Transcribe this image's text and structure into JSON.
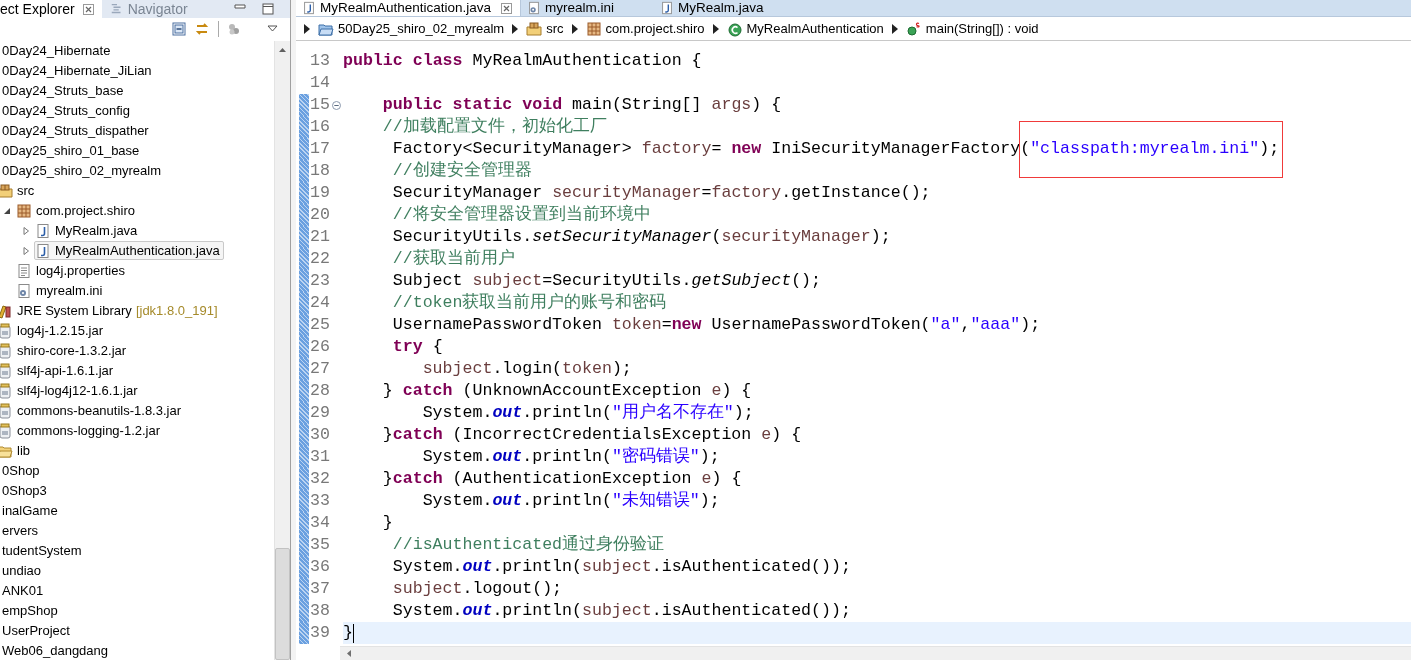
{
  "sidebar": {
    "tabs": [
      {
        "label": "ect Explorer",
        "selected": true
      },
      {
        "label": "Navigator",
        "kind": "navigator",
        "selected": false
      }
    ],
    "tree": [
      {
        "label": "0Day24_Hibernate",
        "selected": false
      },
      {
        "label": "0Day24_Hibernate_JiLian",
        "selected": false
      },
      {
        "label": "0Day24_Struts_base",
        "selected": false
      },
      {
        "label": "0Day24_Struts_config",
        "selected": false
      },
      {
        "label": "0Day24_Struts_dispather",
        "selected": false
      },
      {
        "label": "0Day25_shiro_01_base",
        "selected": false
      },
      {
        "label": "0Day25_shiro_02_myrealm",
        "selected": false,
        "children": [
          {
            "label": "src",
            "kind": "source-folder",
            "selected": false,
            "children": [
              {
                "label": "com.project.shiro",
                "kind": "package",
                "expanded": true,
                "selected": false,
                "children": [
                  {
                    "label": "MyRealm.java",
                    "kind": "java",
                    "expanded": false,
                    "selected": false
                  },
                  {
                    "label": "MyRealmAuthentication.java",
                    "kind": "java",
                    "expanded": false,
                    "selected": true
                  }
                ]
              },
              {
                "label": "log4j.properties",
                "kind": "properties",
                "selected": false
              },
              {
                "label": "myrealm.ini",
                "kind": "ini",
                "selected": false
              }
            ]
          },
          {
            "label": "JRE System Library",
            "decoration": "[jdk1.8.0_191]",
            "kind": "library",
            "selected": false
          },
          {
            "label": "log4j-1.2.15.jar",
            "kind": "jar",
            "selected": false
          },
          {
            "label": "shiro-core-1.3.2.jar",
            "kind": "jar",
            "selected": false
          },
          {
            "label": "slf4j-api-1.6.1.jar",
            "kind": "jar",
            "selected": false
          },
          {
            "label": "slf4j-log4j12-1.6.1.jar",
            "kind": "jar",
            "selected": false
          },
          {
            "label": "commons-beanutils-1.8.3.jar",
            "kind": "jar",
            "selected": false
          },
          {
            "label": "commons-logging-1.2.jar",
            "kind": "jar",
            "selected": false
          },
          {
            "label": "lib",
            "kind": "folder",
            "selected": false
          }
        ]
      },
      {
        "label": "0Shop",
        "selected": false
      },
      {
        "label": "0Shop3",
        "selected": false
      },
      {
        "label": "inalGame",
        "selected": false
      },
      {
        "label": "ervers",
        "selected": false
      },
      {
        "label": "tudentSystem",
        "selected": false
      },
      {
        "label": "undiao",
        "selected": false
      },
      {
        "label": "ANK01",
        "selected": false
      },
      {
        "label": "empShop",
        "selected": false
      },
      {
        "label": "UserProject",
        "selected": false
      },
      {
        "label": "Web06_dangdang",
        "selected": false
      }
    ]
  },
  "editor": {
    "tabs": [
      {
        "label": "MyRealmAuthentication.java",
        "kind": "java",
        "selected": true
      },
      {
        "label": "myrealm.ini",
        "kind": "ini",
        "selected": false
      },
      {
        "label": "MyRealm.java",
        "kind": "java",
        "selected": false
      }
    ],
    "breadcrumb": [
      {
        "label": "50Day25_shiro_02_myrealm",
        "kind": "project"
      },
      {
        "label": "src",
        "kind": "source-folder"
      },
      {
        "label": "com.project.shiro",
        "kind": "package"
      },
      {
        "label": "MyRealmAuthentication",
        "kind": "class"
      },
      {
        "label": "main(String[]) : void",
        "kind": "method"
      }
    ],
    "lines": [
      {
        "number": "13",
        "changed": false,
        "current": false,
        "tokens": [
          {
            "text": "public ",
            "kind": "keyword"
          },
          {
            "text": "class ",
            "kind": "keyword"
          },
          {
            "text": "MyRealmAuthentication {",
            "kind": "plain"
          }
        ]
      },
      {
        "number": "14",
        "changed": false,
        "current": false
      },
      {
        "number": "15",
        "changed": true,
        "current": false,
        "folded": false,
        "tokens": [
          {
            "text": "    public ",
            "kind": "keyword"
          },
          {
            "text": "static ",
            "kind": "keyword"
          },
          {
            "text": "void",
            "kind": "keyword"
          },
          {
            "text": " main(String[] ",
            "kind": "plain"
          },
          {
            "text": "args",
            "kind": "variable"
          },
          {
            "text": ") {",
            "kind": "plain"
          }
        ]
      },
      {
        "number": "16",
        "changed": true,
        "current": false,
        "tokens": [
          {
            "text": "    //加载配置文件，初始化工厂",
            "kind": "comment"
          }
        ]
      },
      {
        "number": "17",
        "changed": true,
        "current": false,
        "tokens": [
          {
            "text": "     Factory<SecurityManager> ",
            "kind": "plain"
          },
          {
            "text": "factory",
            "kind": "variable"
          },
          {
            "text": "= ",
            "kind": "plain"
          },
          {
            "text": "new",
            "kind": "keyword"
          },
          {
            "text": " IniSecurityManagerFactory",
            "kind": "plain"
          },
          {
            "text": "(",
            "kind": "plain",
            "boxed": true
          },
          {
            "text": "\"classpath:myrealm.ini\"",
            "kind": "string",
            "boxed": true
          },
          {
            "text": ");",
            "kind": "plain",
            "boxed": true
          }
        ]
      },
      {
        "number": "18",
        "changed": true,
        "current": false,
        "tokens": [
          {
            "text": "     //创建安全管理器",
            "kind": "comment"
          }
        ]
      },
      {
        "number": "19",
        "changed": true,
        "current": false,
        "tokens": [
          {
            "text": "     SecurityManager ",
            "kind": "plain"
          },
          {
            "text": "securityManager",
            "kind": "variable"
          },
          {
            "text": "=",
            "kind": "plain"
          },
          {
            "text": "factory",
            "kind": "variable"
          },
          {
            "text": ".getInstance();",
            "kind": "plain"
          }
        ]
      },
      {
        "number": "20",
        "changed": true,
        "current": false,
        "tokens": [
          {
            "text": "     //将安全管理器设置到当前环境中",
            "kind": "comment"
          }
        ]
      },
      {
        "number": "21",
        "changed": true,
        "current": false,
        "tokens": [
          {
            "text": "     SecurityUtils.",
            "kind": "plain"
          },
          {
            "text": "setSecurityManager",
            "kind": "static"
          },
          {
            "text": "(",
            "kind": "plain"
          },
          {
            "text": "securityManager",
            "kind": "variable"
          },
          {
            "text": ");",
            "kind": "plain"
          }
        ]
      },
      {
        "number": "22",
        "changed": true,
        "current": false,
        "tokens": [
          {
            "text": "     //获取当前用户",
            "kind": "comment"
          }
        ]
      },
      {
        "number": "23",
        "changed": true,
        "current": false,
        "tokens": [
          {
            "text": "     Subject ",
            "kind": "plain"
          },
          {
            "text": "subject",
            "kind": "variable"
          },
          {
            "text": "=SecurityUtils.",
            "kind": "plain"
          },
          {
            "text": "getSubject",
            "kind": "static"
          },
          {
            "text": "();",
            "kind": "plain"
          }
        ]
      },
      {
        "number": "24",
        "changed": true,
        "current": false,
        "tokens": [
          {
            "text": "     //token获取当前用户的账号和密码",
            "kind": "comment"
          }
        ]
      },
      {
        "number": "25",
        "changed": true,
        "current": false,
        "tokens": [
          {
            "text": "     UsernamePasswordToken ",
            "kind": "plain"
          },
          {
            "text": "token",
            "kind": "variable"
          },
          {
            "text": "=",
            "kind": "plain"
          },
          {
            "text": "new",
            "kind": "keyword"
          },
          {
            "text": " UsernamePasswordToken(",
            "kind": "plain"
          },
          {
            "text": "\"a\"",
            "kind": "string"
          },
          {
            "text": ",",
            "kind": "plain"
          },
          {
            "text": "\"aaa\"",
            "kind": "string"
          },
          {
            "text": ");",
            "kind": "plain"
          }
        ]
      },
      {
        "number": "26",
        "changed": true,
        "current": false,
        "tokens": [
          {
            "text": "     try",
            "kind": "keyword"
          },
          {
            "text": " {",
            "kind": "plain"
          }
        ]
      },
      {
        "number": "27",
        "changed": true,
        "current": false,
        "tokens": [
          {
            "text": "        subject",
            "kind": "variable"
          },
          {
            "text": ".login(",
            "kind": "plain"
          },
          {
            "text": "token",
            "kind": "variable"
          },
          {
            "text": ");",
            "kind": "plain"
          }
        ]
      },
      {
        "number": "28",
        "changed": true,
        "current": false,
        "tokens": [
          {
            "text": "    } ",
            "kind": "plain"
          },
          {
            "text": "catch",
            "kind": "keyword"
          },
          {
            "text": " (UnknownAccountException ",
            "kind": "plain"
          },
          {
            "text": "e",
            "kind": "variable"
          },
          {
            "text": ") {",
            "kind": "plain"
          }
        ]
      },
      {
        "number": "29",
        "changed": true,
        "current": false,
        "tokens": [
          {
            "text": "        System.",
            "kind": "plain"
          },
          {
            "text": "out",
            "kind": "field"
          },
          {
            "text": ".println(",
            "kind": "plain"
          },
          {
            "text": "\"用户名不存在\"",
            "kind": "string"
          },
          {
            "text": ");",
            "kind": "plain"
          }
        ]
      },
      {
        "number": "30",
        "changed": true,
        "current": false,
        "tokens": [
          {
            "text": "    }",
            "kind": "plain"
          },
          {
            "text": "catch",
            "kind": "keyword"
          },
          {
            "text": " (IncorrectCredentialsException ",
            "kind": "plain"
          },
          {
            "text": "e",
            "kind": "variable"
          },
          {
            "text": ") {",
            "kind": "plain"
          }
        ]
      },
      {
        "number": "31",
        "changed": true,
        "current": false,
        "tokens": [
          {
            "text": "        System.",
            "kind": "plain"
          },
          {
            "text": "out",
            "kind": "field"
          },
          {
            "text": ".println(",
            "kind": "plain"
          },
          {
            "text": "\"密码错误\"",
            "kind": "string"
          },
          {
            "text": ");",
            "kind": "plain"
          }
        ]
      },
      {
        "number": "32",
        "changed": true,
        "current": false,
        "tokens": [
          {
            "text": "    }",
            "kind": "plain"
          },
          {
            "text": "catch",
            "kind": "keyword"
          },
          {
            "text": " (AuthenticationException ",
            "kind": "plain"
          },
          {
            "text": "e",
            "kind": "variable"
          },
          {
            "text": ") {",
            "kind": "plain"
          }
        ]
      },
      {
        "number": "33",
        "changed": true,
        "current": false,
        "tokens": [
          {
            "text": "        System.",
            "kind": "plain"
          },
          {
            "text": "out",
            "kind": "field"
          },
          {
            "text": ".println(",
            "kind": "plain"
          },
          {
            "text": "\"未知错误\"",
            "kind": "string"
          },
          {
            "text": ");",
            "kind": "plain"
          }
        ]
      },
      {
        "number": "34",
        "changed": true,
        "current": false,
        "tokens": [
          {
            "text": "    }",
            "kind": "plain"
          }
        ]
      },
      {
        "number": "35",
        "changed": true,
        "current": false,
        "tokens": [
          {
            "text": "     //isAuthenticated通过身份验证",
            "kind": "comment"
          }
        ]
      },
      {
        "number": "36",
        "changed": true,
        "current": false,
        "tokens": [
          {
            "text": "     System.",
            "kind": "plain"
          },
          {
            "text": "out",
            "kind": "field"
          },
          {
            "text": ".println(",
            "kind": "plain"
          },
          {
            "text": "subject",
            "kind": "variable"
          },
          {
            "text": ".isAuthenticated());",
            "kind": "plain"
          }
        ]
      },
      {
        "number": "37",
        "changed": true,
        "current": false,
        "tokens": [
          {
            "text": "     subject",
            "kind": "variable"
          },
          {
            "text": ".logout();",
            "kind": "plain"
          }
        ]
      },
      {
        "number": "38",
        "changed": true,
        "current": false,
        "tokens": [
          {
            "text": "     System.",
            "kind": "plain"
          },
          {
            "text": "out",
            "kind": "field"
          },
          {
            "text": ".println(",
            "kind": "plain"
          },
          {
            "text": "subject",
            "kind": "variable"
          },
          {
            "text": ".isAuthenticated());",
            "kind": "plain"
          }
        ]
      },
      {
        "number": "39",
        "changed": true,
        "current": true,
        "tokens": [
          {
            "text": "}",
            "kind": "plain"
          }
        ]
      }
    ]
  }
}
